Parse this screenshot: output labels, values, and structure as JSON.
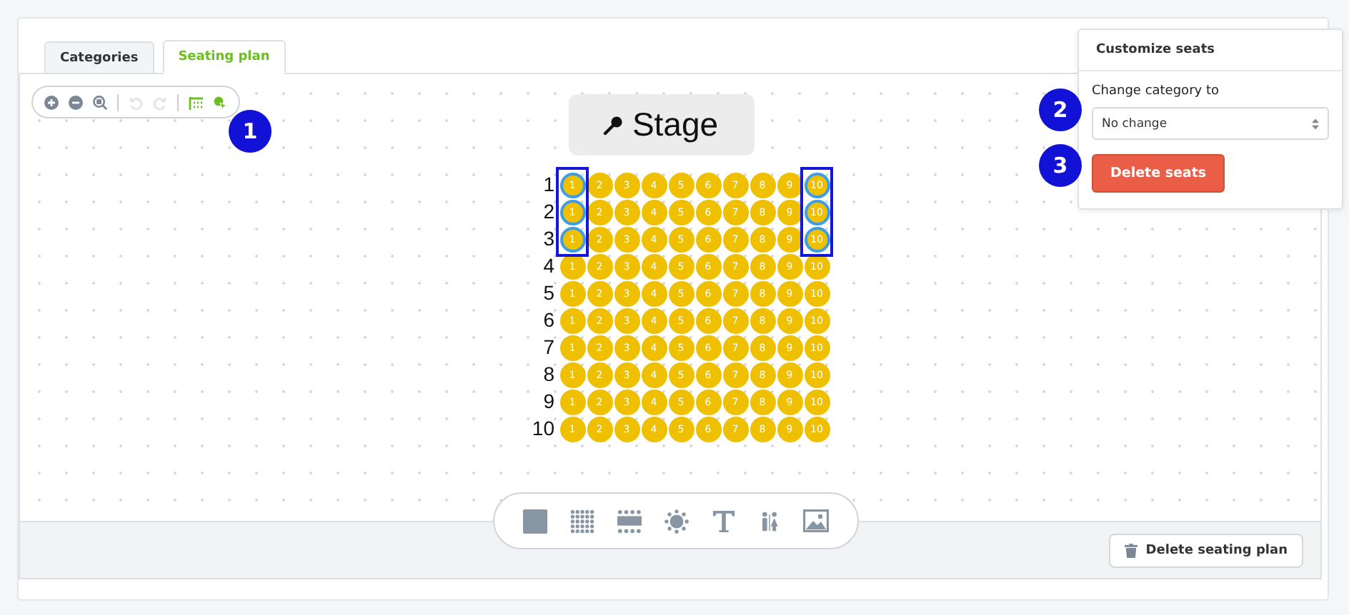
{
  "tabs": [
    {
      "label": "Categories",
      "selected": false
    },
    {
      "label": "Seating plan",
      "selected": true
    }
  ],
  "toolbar": [
    {
      "kind": "zoomin",
      "disabled": false
    },
    {
      "kind": "zoomout",
      "disabled": false
    },
    {
      "kind": "zoomreset",
      "disabled": false
    },
    {
      "kind": "divider"
    },
    {
      "kind": "undo",
      "disabled": true
    },
    {
      "kind": "redo",
      "disabled": true
    },
    {
      "kind": "divider"
    },
    {
      "kind": "rowselect",
      "disabled": false
    },
    {
      "kind": "seatselect",
      "disabled": false
    }
  ],
  "stage": {
    "label": "Stage"
  },
  "rows": [
    {
      "label": "1",
      "seats": [
        {
          "label": "1",
          "selected": true
        },
        {
          "label": "2",
          "selected": false
        },
        {
          "label": "3",
          "selected": false
        },
        {
          "label": "4",
          "selected": false
        },
        {
          "label": "5",
          "selected": false
        },
        {
          "label": "6",
          "selected": false
        },
        {
          "label": "7",
          "selected": false
        },
        {
          "label": "8",
          "selected": false
        },
        {
          "label": "9",
          "selected": false
        },
        {
          "label": "10",
          "selected": true
        }
      ]
    },
    {
      "label": "2",
      "seats": [
        {
          "label": "1",
          "selected": true
        },
        {
          "label": "2",
          "selected": false
        },
        {
          "label": "3",
          "selected": false
        },
        {
          "label": "4",
          "selected": false
        },
        {
          "label": "5",
          "selected": false
        },
        {
          "label": "6",
          "selected": false
        },
        {
          "label": "7",
          "selected": false
        },
        {
          "label": "8",
          "selected": false
        },
        {
          "label": "9",
          "selected": false
        },
        {
          "label": "10",
          "selected": true
        }
      ]
    },
    {
      "label": "3",
      "seats": [
        {
          "label": "1",
          "selected": true
        },
        {
          "label": "2",
          "selected": false
        },
        {
          "label": "3",
          "selected": false
        },
        {
          "label": "4",
          "selected": false
        },
        {
          "label": "5",
          "selected": false
        },
        {
          "label": "6",
          "selected": false
        },
        {
          "label": "7",
          "selected": false
        },
        {
          "label": "8",
          "selected": false
        },
        {
          "label": "9",
          "selected": false
        },
        {
          "label": "10",
          "selected": true
        }
      ]
    },
    {
      "label": "4",
      "seats": [
        {
          "label": "1",
          "selected": false
        },
        {
          "label": "2",
          "selected": false
        },
        {
          "label": "3",
          "selected": false
        },
        {
          "label": "4",
          "selected": false
        },
        {
          "label": "5",
          "selected": false
        },
        {
          "label": "6",
          "selected": false
        },
        {
          "label": "7",
          "selected": false
        },
        {
          "label": "8",
          "selected": false
        },
        {
          "label": "9",
          "selected": false
        },
        {
          "label": "10",
          "selected": false
        }
      ]
    },
    {
      "label": "5",
      "seats": [
        {
          "label": "1",
          "selected": false
        },
        {
          "label": "2",
          "selected": false
        },
        {
          "label": "3",
          "selected": false
        },
        {
          "label": "4",
          "selected": false
        },
        {
          "label": "5",
          "selected": false
        },
        {
          "label": "6",
          "selected": false
        },
        {
          "label": "7",
          "selected": false
        },
        {
          "label": "8",
          "selected": false
        },
        {
          "label": "9",
          "selected": false
        },
        {
          "label": "10",
          "selected": false
        }
      ]
    },
    {
      "label": "6",
      "seats": [
        {
          "label": "1",
          "selected": false
        },
        {
          "label": "2",
          "selected": false
        },
        {
          "label": "3",
          "selected": false
        },
        {
          "label": "4",
          "selected": false
        },
        {
          "label": "5",
          "selected": false
        },
        {
          "label": "6",
          "selected": false
        },
        {
          "label": "7",
          "selected": false
        },
        {
          "label": "8",
          "selected": false
        },
        {
          "label": "9",
          "selected": false
        },
        {
          "label": "10",
          "selected": false
        }
      ]
    },
    {
      "label": "7",
      "seats": [
        {
          "label": "1",
          "selected": false
        },
        {
          "label": "2",
          "selected": false
        },
        {
          "label": "3",
          "selected": false
        },
        {
          "label": "4",
          "selected": false
        },
        {
          "label": "5",
          "selected": false
        },
        {
          "label": "6",
          "selected": false
        },
        {
          "label": "7",
          "selected": false
        },
        {
          "label": "8",
          "selected": false
        },
        {
          "label": "9",
          "selected": false
        },
        {
          "label": "10",
          "selected": false
        }
      ]
    },
    {
      "label": "8",
      "seats": [
        {
          "label": "1",
          "selected": false
        },
        {
          "label": "2",
          "selected": false
        },
        {
          "label": "3",
          "selected": false
        },
        {
          "label": "4",
          "selected": false
        },
        {
          "label": "5",
          "selected": false
        },
        {
          "label": "6",
          "selected": false
        },
        {
          "label": "7",
          "selected": false
        },
        {
          "label": "8",
          "selected": false
        },
        {
          "label": "9",
          "selected": false
        },
        {
          "label": "10",
          "selected": false
        }
      ]
    },
    {
      "label": "9",
      "seats": [
        {
          "label": "1",
          "selected": false
        },
        {
          "label": "2",
          "selected": false
        },
        {
          "label": "3",
          "selected": false
        },
        {
          "label": "4",
          "selected": false
        },
        {
          "label": "5",
          "selected": false
        },
        {
          "label": "6",
          "selected": false
        },
        {
          "label": "7",
          "selected": false
        },
        {
          "label": "8",
          "selected": false
        },
        {
          "label": "9",
          "selected": false
        },
        {
          "label": "10",
          "selected": false
        }
      ]
    },
    {
      "label": "10",
      "seats": [
        {
          "label": "1",
          "selected": false
        },
        {
          "label": "2",
          "selected": false
        },
        {
          "label": "3",
          "selected": false
        },
        {
          "label": "4",
          "selected": false
        },
        {
          "label": "5",
          "selected": false
        },
        {
          "label": "6",
          "selected": false
        },
        {
          "label": "7",
          "selected": false
        },
        {
          "label": "8",
          "selected": false
        },
        {
          "label": "9",
          "selected": false
        },
        {
          "label": "10",
          "selected": false
        }
      ]
    }
  ],
  "tools": [
    {
      "kind": "square"
    },
    {
      "kind": "grid"
    },
    {
      "kind": "table"
    },
    {
      "kind": "roundtable"
    },
    {
      "kind": "text"
    },
    {
      "kind": "restroom"
    },
    {
      "kind": "image"
    }
  ],
  "footer": {
    "button": "Delete seating plan"
  },
  "popover": {
    "title": "Customize seats",
    "field_label": "Change category to",
    "select_value": "No change",
    "delete_button": "Delete seats"
  },
  "callouts": [
    "1",
    "2",
    "3"
  ]
}
